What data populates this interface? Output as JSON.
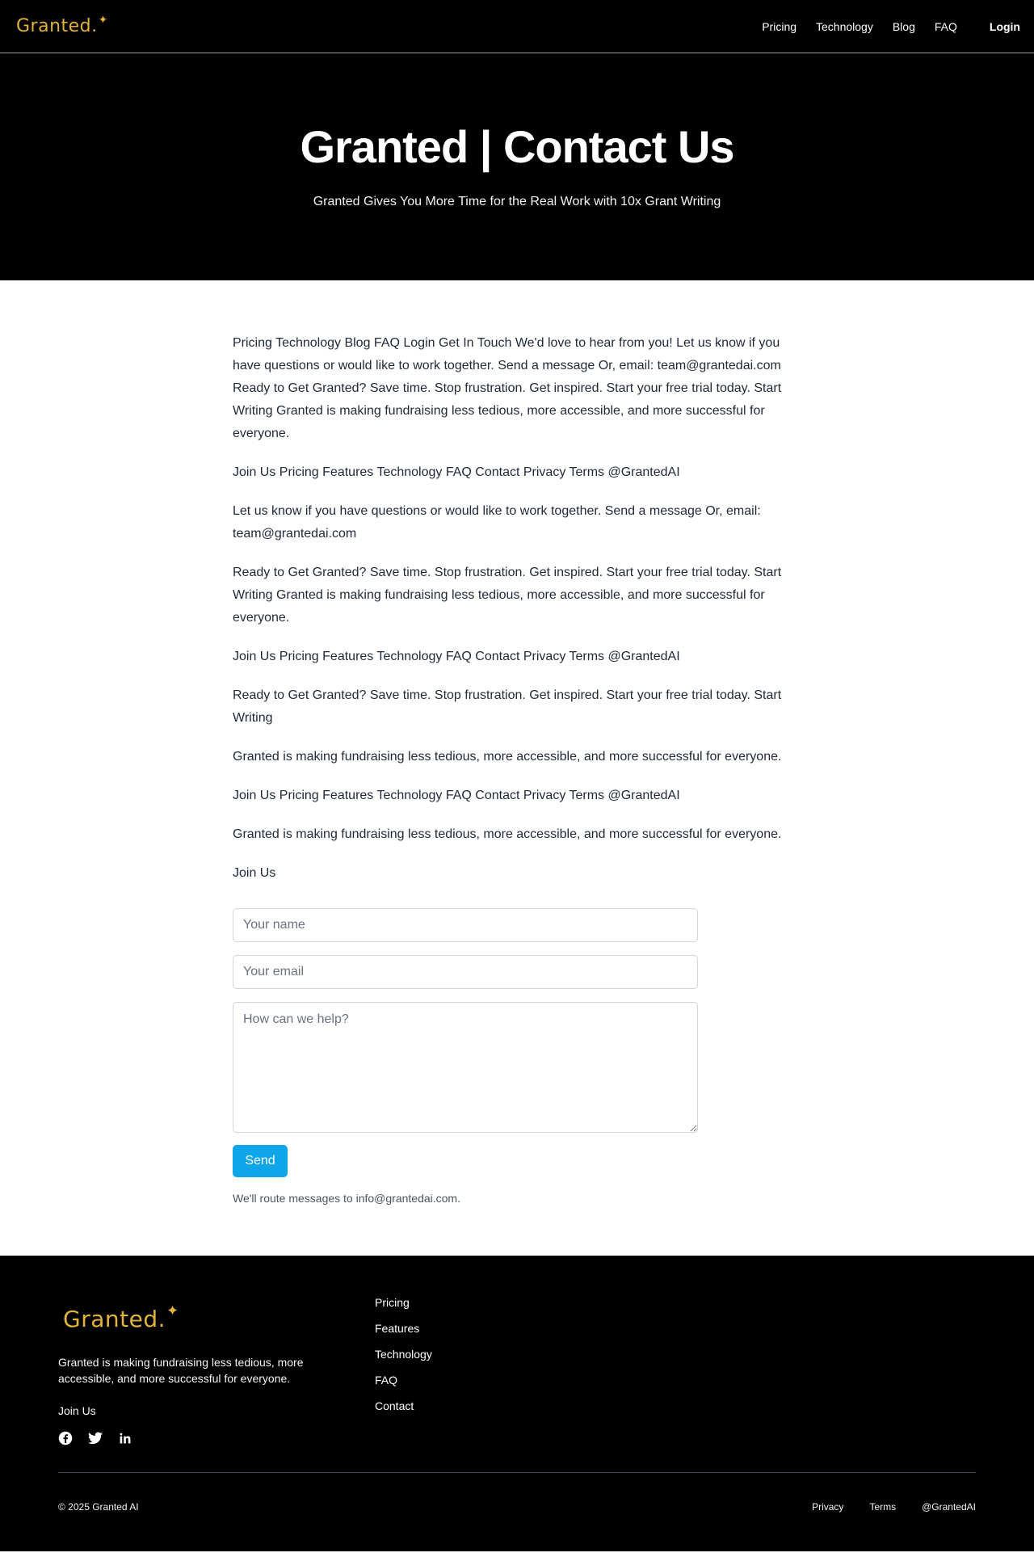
{
  "nav": {
    "logo": "Granted.",
    "links": [
      "Pricing",
      "Technology",
      "Blog",
      "FAQ"
    ],
    "login": "Login"
  },
  "hero": {
    "title": "Granted | Contact Us",
    "subtitle": "Granted Gives You More Time for the Real Work with 10x Grant Writing"
  },
  "content": {
    "paragraphs": [
      "Pricing Technology Blog FAQ Login Get In Touch We'd love to hear from you! Let us know if you have questions or would like to work together. Send a message Or, email: team@grantedai.com Ready to Get Granted? Save time. Stop frustration. Get inspired. Start your free trial today. Start Writing Granted is making fundraising less tedious, more accessible, and more successful for everyone.",
      "Join Us Pricing Features Technology FAQ Contact Privacy Terms @GrantedAI",
      "Let us know if you have questions or would like to work together. Send a message Or, email: team@grantedai.com",
      "Ready to Get Granted? Save time. Stop frustration. Get inspired. Start your free trial today. Start Writing Granted is making fundraising less tedious, more accessible, and more successful for everyone.",
      "Join Us Pricing Features Technology FAQ Contact Privacy Terms @GrantedAI",
      "Ready to Get Granted? Save time. Stop frustration. Get inspired. Start your free trial today. Start Writing",
      "Granted is making fundraising less tedious, more accessible, and more successful for everyone.",
      "Join Us Pricing Features Technology FAQ Contact Privacy Terms @GrantedAI",
      "Granted is making fundraising less tedious, more accessible, and more successful for everyone.",
      "Join Us"
    ]
  },
  "form": {
    "name_placeholder": "Your name",
    "name_value": "",
    "email_placeholder": "Your email",
    "email_value": "",
    "message_placeholder": "How can we help?",
    "message_value": "",
    "send_label": "Send",
    "note": "We'll route messages to info@grantedai.com."
  },
  "footer": {
    "logo": "Granted.",
    "tagline": "Granted is making fundraising less tedious, more accessible, and more successful for everyone.",
    "join": "Join Us",
    "social_icons": [
      "facebook-icon",
      "twitter-icon",
      "linkedin-icon"
    ],
    "links": [
      "Pricing",
      "Features",
      "Technology",
      "FAQ",
      "Contact"
    ],
    "copyright": "© 2025 Granted AI",
    "bottom_links": [
      "Privacy",
      "Terms",
      "@GrantedAI"
    ]
  },
  "colors": {
    "brand_gold": "#e2b33b",
    "accent_blue": "#0ea5e9",
    "background_dark": "#000000"
  }
}
